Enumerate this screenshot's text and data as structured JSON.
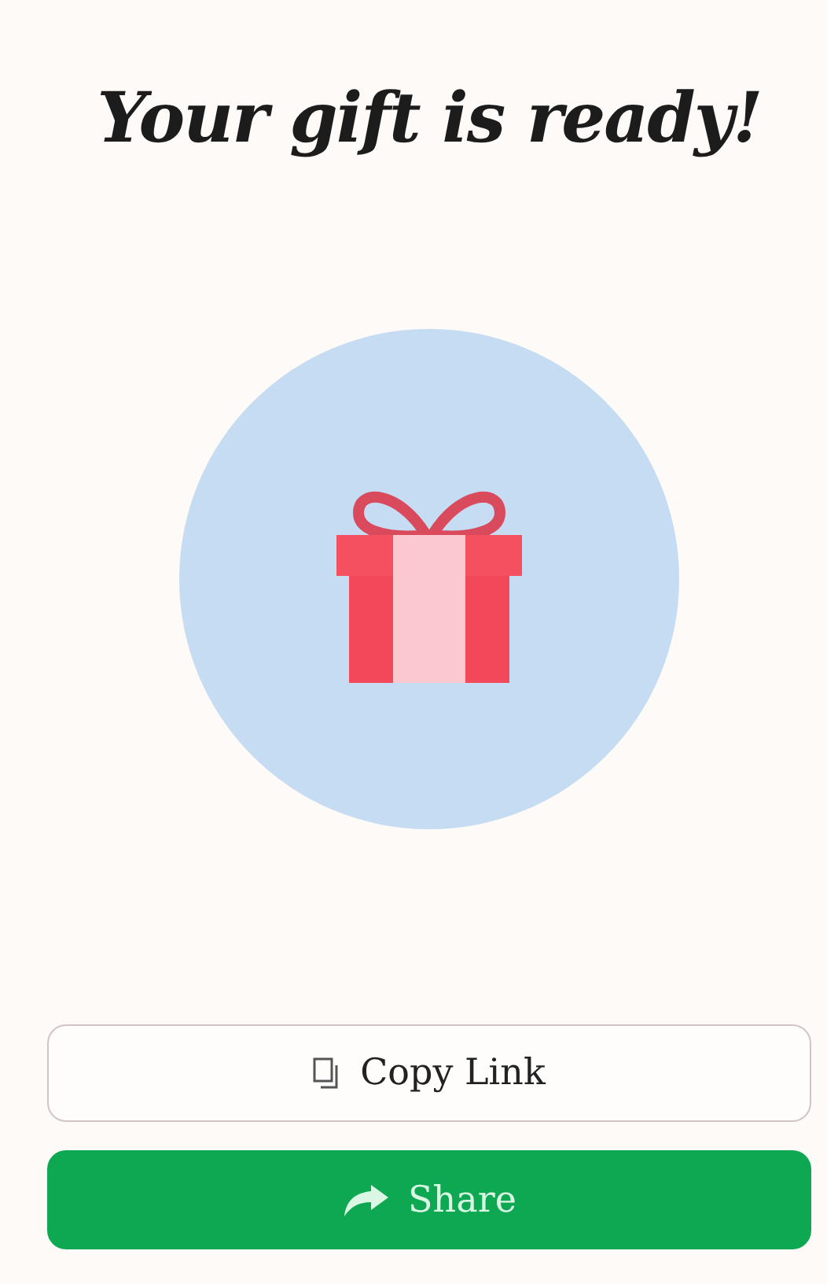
{
  "title": "Your gift is ready!",
  "buttons": [
    {
      "kind": "outline",
      "label": "Copy Link"
    },
    {
      "kind": "primary",
      "label": "Share"
    }
  ]
}
